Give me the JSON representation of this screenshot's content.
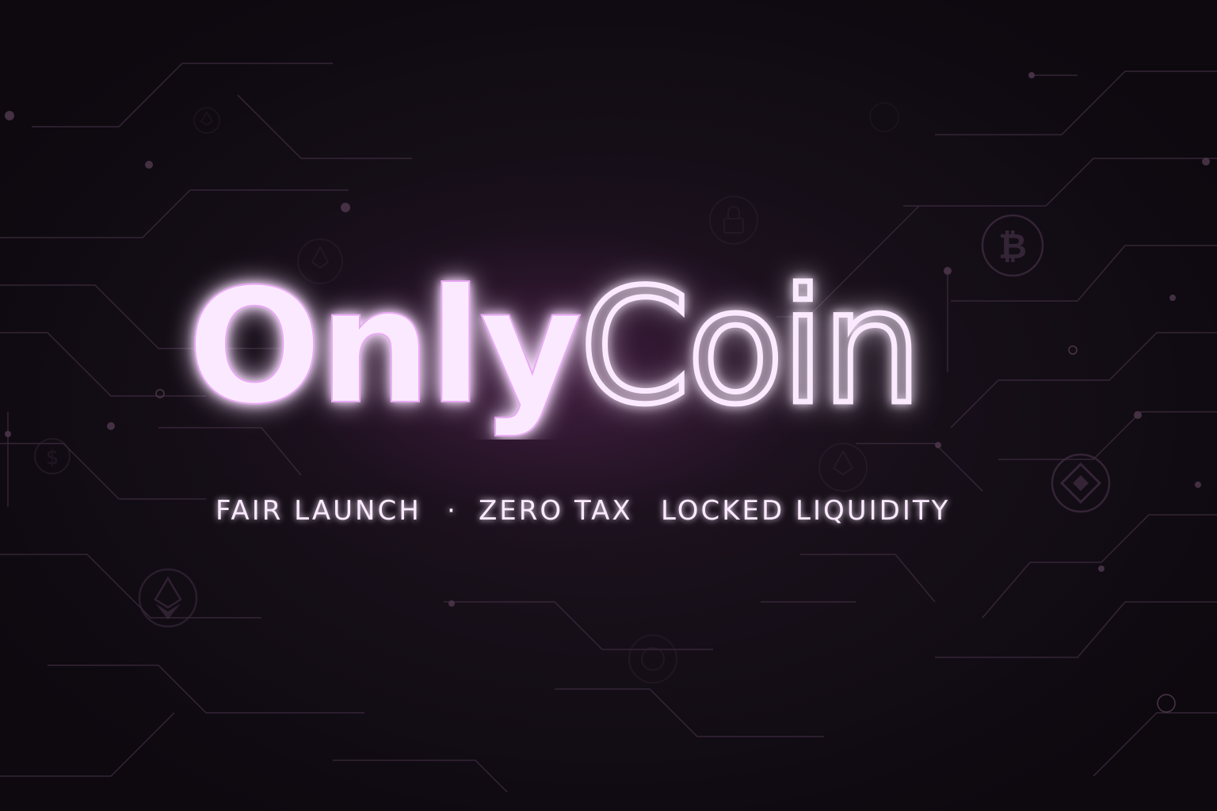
{
  "brand": {
    "name_part1": "Only",
    "name_part2": "Coin"
  },
  "tagline": {
    "item1": "FAIR LAUNCH",
    "separator": "·",
    "item2": "ZERO TAX",
    "item3": "LOCKED LIQUIDITY"
  },
  "background_icons": [
    "bitcoin-icon",
    "binance-icon",
    "ethereum-icon",
    "ethereum-icon",
    "dollar-coin-icon",
    "lock-icon",
    "coin-icon"
  ],
  "colors": {
    "background": "#100b12",
    "glow": "#d77cf0",
    "text": "#fbe9ff",
    "circuit": "#3a2a3c"
  }
}
